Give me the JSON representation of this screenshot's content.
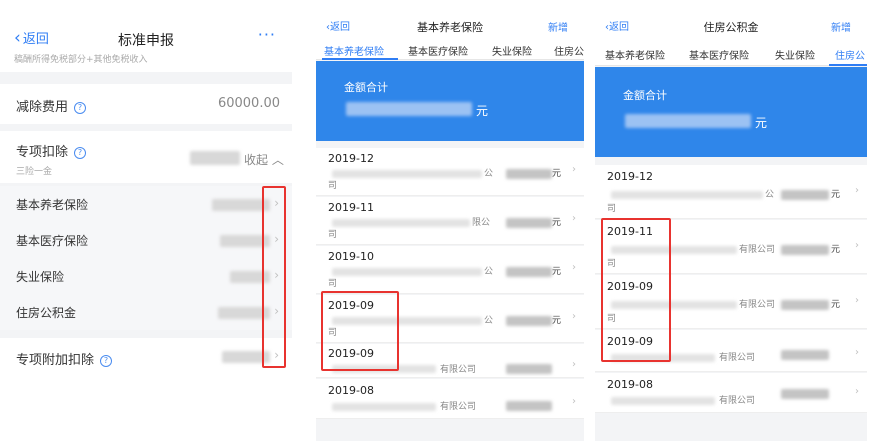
{
  "panel1": {
    "back": "返回",
    "title": "标准申报",
    "more": "···",
    "note": "稿酬所得免税部分+其他免税收入",
    "deduction": {
      "label": "减除费用",
      "value": "60000.00"
    },
    "special": {
      "label": "专项扣除",
      "sub": "三险一金",
      "collapse": "收起 ︿"
    },
    "items": [
      {
        "label": "基本养老保险"
      },
      {
        "label": "基本医疗保险"
      },
      {
        "label": "失业保险"
      },
      {
        "label": "住房公积金"
      }
    ],
    "additional": {
      "label": "专项附加扣除"
    },
    "help": "?"
  },
  "panel2": {
    "back": "返回",
    "title": "基本养老保险",
    "add": "新增",
    "tabs": [
      "基本养老保险",
      "基本医疗保险",
      "失业保险",
      "住房公"
    ],
    "active_tab": 0,
    "total_label": "金额合计",
    "unit": "元",
    "records": [
      {
        "date": "2019-12",
        "co_frag": "公",
        "co_tail": "司",
        "amt_frag": "元"
      },
      {
        "date": "2019-11",
        "co_frag": "限公",
        "co_tail": "司",
        "amt_frag": "元"
      },
      {
        "date": "2019-10",
        "co_frag": "公",
        "co_tail": "司",
        "amt_frag": "元"
      },
      {
        "date": "2019-09",
        "co_frag": "公",
        "co_tail": "司",
        "amt_frag": "元"
      },
      {
        "date": "2019-09",
        "co_frag": "有限公司",
        "co_tail": "",
        "amt_frag": ""
      },
      {
        "date": "2019-08",
        "co_frag": "有限公司",
        "co_tail": "",
        "amt_frag": ""
      }
    ]
  },
  "panel3": {
    "back": "返回",
    "title": "住房公积金",
    "add": "新增",
    "tabs": [
      "基本养老保险",
      "基本医疗保险",
      "失业保险",
      "住房公"
    ],
    "active_tab": 3,
    "total_label": "金额合计",
    "unit": "元",
    "records": [
      {
        "date": "2019-12",
        "co_frag": "公",
        "co_tail": "司",
        "amt_frag": "元"
      },
      {
        "date": "2019-11",
        "co_frag": "有限公司",
        "co_tail": "司",
        "amt_frag": "元"
      },
      {
        "date": "2019-09",
        "co_frag": "有限公司",
        "co_tail": "司",
        "amt_frag": "元"
      },
      {
        "date": "2019-09",
        "co_frag": "有限公司",
        "co_tail": "",
        "amt_frag": ""
      },
      {
        "date": "2019-08",
        "co_frag": "有限公司",
        "co_tail": "",
        "amt_frag": ""
      }
    ]
  },
  "colors": {
    "accent": "#2f7df4",
    "banner": "#2f86ea",
    "highlight": "#e8332f"
  },
  "icons": [
    "back-chevron-icon",
    "more-icon",
    "help-icon",
    "chevron-right-icon"
  ]
}
